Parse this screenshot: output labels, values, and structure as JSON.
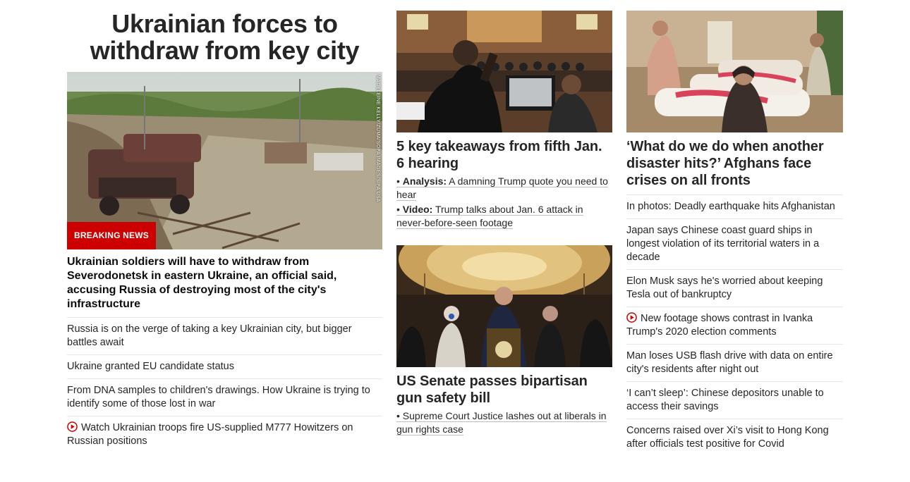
{
  "left": {
    "headline": "Ukrainian forces to withdraw from key city",
    "photo_credit": "MADELEINE KELLY/ZUMA/SOPA IMAGES/SIPA USA",
    "badge": "BREAKING NEWS",
    "lead": "Ukrainian soldiers will have to withdraw from Severodonetsk in eastern Ukraine, an official said, accusing Russia of destroying most of the city's infrastructure",
    "items": [
      {
        "text": "Russia is on the verge of taking a key Ukrainian city, but bigger battles await",
        "video": false
      },
      {
        "text": "Ukraine granted EU candidate status",
        "video": false
      },
      {
        "text": "From DNA samples to children's drawings. How Ukraine is trying to identify some of those lost in war",
        "video": false
      },
      {
        "text": "Watch Ukrainian troops fire US-supplied M777 Howitzers on Russian positions",
        "video": true
      }
    ]
  },
  "middle": {
    "card1": {
      "title": "5 key takeaways from fifth Jan. 6 hearing",
      "links": [
        {
          "prefix": "Analysis:",
          "text": "A damning Trump quote you need to hear"
        },
        {
          "prefix": "Video:",
          "text": "Trump talks about Jan. 6 attack in never-before-seen footage"
        }
      ]
    },
    "card2": {
      "title": "US Senate passes bipartisan gun safety bill",
      "links": [
        {
          "text": "Supreme Court Justice lashes out at liberals in gun rights case"
        }
      ]
    }
  },
  "right": {
    "title": "‘What do we do when another disaster hits?’ Afghans face crises on all fronts",
    "items": [
      {
        "text": "In photos: Deadly earthquake hits Afghanistan",
        "video": false
      },
      {
        "text": "Japan says Chinese coast guard ships in longest violation of its territorial waters in a decade",
        "video": false
      },
      {
        "text": "Elon Musk says he's worried about keeping Tesla out of bankruptcy",
        "video": false
      },
      {
        "text": "New footage shows contrast in Ivanka Trump's 2020 election comments",
        "video": true
      },
      {
        "text": "Man loses USB flash drive with data on entire city's residents after night out",
        "video": false
      },
      {
        "text": "‘I can’t sleep’: Chinese depositors unable to access their savings",
        "video": false
      },
      {
        "text": "Concerns raised over Xi’s visit to Hong Kong after officials test positive for Covid",
        "video": false
      }
    ]
  },
  "colors": {
    "accent": "#cc0000",
    "text": "#262626",
    "divider": "#e6e6e6"
  }
}
